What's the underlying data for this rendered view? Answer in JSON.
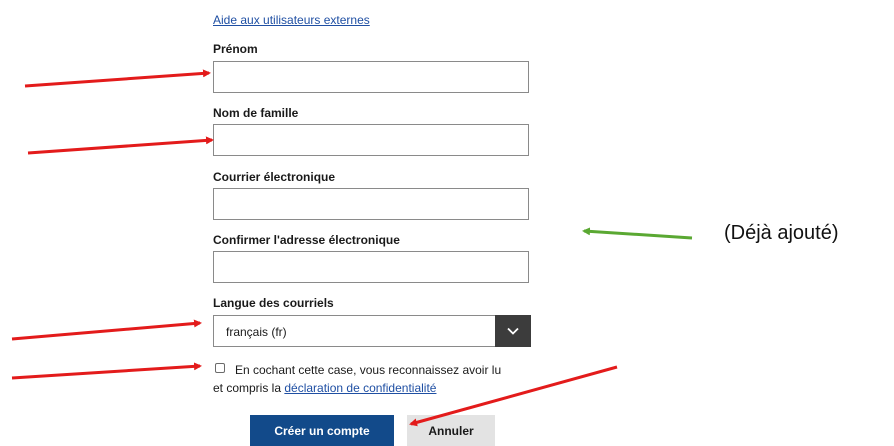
{
  "form": {
    "help_link": "Aide aux utilisateurs externes",
    "first_name_label": "Prénom",
    "last_name_label": "Nom de famille",
    "email_label": "Courrier électronique",
    "confirm_email_label": "Confirmer l'adresse électronique",
    "language_label": "Langue des courriels",
    "language_value": "français (fr)",
    "consent_text_part1": "En cochant cette case, vous reconnaissez avoir lu",
    "consent_text_part2": "et compris la ",
    "consent_link": "déclaration de confidentialité",
    "create_button": "Créer un compte",
    "cancel_button": "Annuler"
  },
  "annotation": {
    "note": "(Déjà ajouté)",
    "red_arrow_color": "#e31b1b",
    "green_arrow_color": "#5aa832"
  },
  "colors": {
    "primary_button": "#124a8a",
    "link": "#1f4fa3",
    "select_button": "#3c3c3c"
  }
}
